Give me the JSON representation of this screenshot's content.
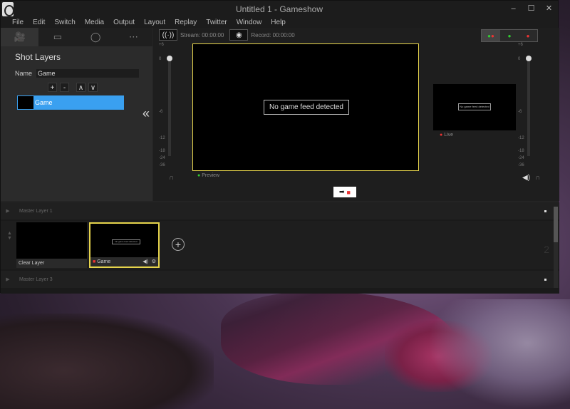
{
  "window": {
    "title": "Untitled 1 - Gameshow",
    "controls": [
      "–",
      "☐",
      "✕"
    ]
  },
  "menu": [
    "File",
    "Edit",
    "Switch",
    "Media",
    "Output",
    "Layout",
    "Replay",
    "Twitter",
    "Window",
    "Help"
  ],
  "left_panel": {
    "tabs": [
      "camera-icon",
      "film-icon",
      "person-icon",
      "more-icon"
    ],
    "title": "Shot Layers",
    "name_label": "Name",
    "name_value": "Game",
    "buttons": [
      "+",
      "-",
      "∧",
      "∨"
    ],
    "layers": [
      {
        "label": "Game"
      }
    ],
    "collapse": "«"
  },
  "top_bar": {
    "stream_label": "Stream: 00:00:00",
    "record_label": "Record: 00:00:00"
  },
  "left_vu_ticks": [
    "+6",
    "0",
    "-6",
    "-12",
    "-18",
    "-24",
    "-36"
  ],
  "right_vu_ticks": [
    "+6",
    "0",
    "-6",
    "-12",
    "-18",
    "-24",
    "-36"
  ],
  "preview": {
    "message": "No game feed detected",
    "label": "Preview"
  },
  "live": {
    "label": "Live",
    "mini_text": "No game feed detected"
  },
  "transition_button": "➡",
  "master_layers": [
    {
      "label": "Master Layer 1"
    },
    {
      "label": "Master Layer 3"
    }
  ],
  "layer2": {
    "number": "2",
    "sources": [
      {
        "label": "Clear Layer"
      },
      {
        "label": "Game",
        "mini_text": "No game feed detected"
      }
    ],
    "add": "+"
  },
  "colors": {
    "preview_border": "#e6d44c",
    "selection": "#3aa0f0",
    "live_dot": "#e33333",
    "preview_dot": "#33cc33"
  }
}
